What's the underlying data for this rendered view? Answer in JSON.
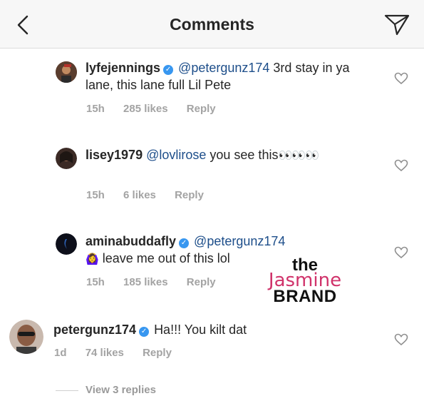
{
  "header": {
    "title": "Comments"
  },
  "comments": [
    {
      "username": "lyfejennings",
      "mention": "@petergunz174",
      "text": " 3rd stay in ya lane, this lane full Lil Pete",
      "time": "15h",
      "likes": "285 likes",
      "reply": "Reply"
    },
    {
      "username": "lisey1979",
      "mention": "@lovlirose",
      "text": " you see this",
      "emoji": "👀👀👀",
      "time": "15h",
      "likes": "6 likes",
      "reply": "Reply"
    },
    {
      "username": "aminabuddafly",
      "mention": "@petergunz174",
      "emoji": "🙆‍♀️",
      "text": " leave me out of this lol",
      "time": "15h",
      "likes": "185 likes",
      "reply": "Reply"
    },
    {
      "username": "petergunz174",
      "text": "Ha!!! You kilt dat",
      "time": "1d",
      "likes": "74 likes",
      "reply": "Reply"
    }
  ],
  "view_replies": "View 3 replies",
  "watermark": {
    "the": "the",
    "jasmine": "Jasmine",
    "brand": "BRAND"
  },
  "colors": {
    "mention": "#1d4e8a",
    "verified": "#3897f0",
    "meta": "#a3a3a3",
    "watermark_pink": "#d0326a"
  }
}
